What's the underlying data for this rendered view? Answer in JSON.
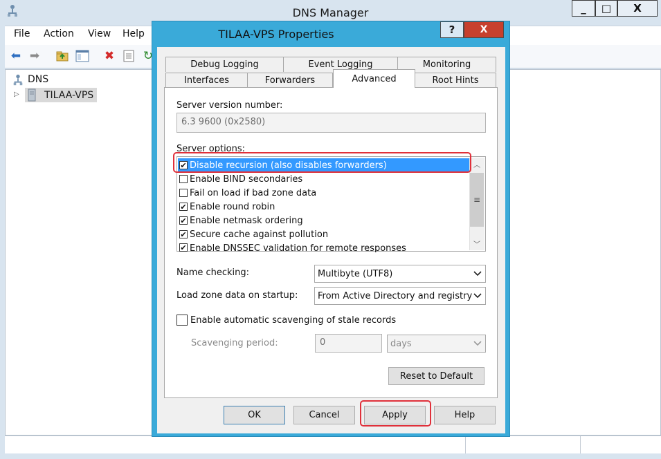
{
  "main_window": {
    "title": "DNS Manager",
    "controls": {
      "minimize": "_",
      "maximize": "□",
      "close": "X"
    },
    "menu": [
      "File",
      "Action",
      "View",
      "Help"
    ],
    "toolbar_icons": [
      "back-arrow-icon",
      "forward-arrow-icon",
      "up-folder-icon",
      "console-tree-icon",
      "delete-icon",
      "properties-icon",
      "refresh-icon"
    ],
    "tree": {
      "root": "DNS",
      "child": "TILAA-VPS",
      "expander": "▷"
    }
  },
  "dialog": {
    "title": "TILAA-VPS Properties",
    "help_symbol": "?",
    "close_symbol": "X",
    "tabs_row1": [
      "Debug Logging",
      "Event Logging",
      "Monitoring"
    ],
    "tabs_row2": [
      "Interfaces",
      "Forwarders",
      "Advanced",
      "Root Hints"
    ],
    "active_tab": "Advanced",
    "server_version_label": "Server version number:",
    "server_version_value": "6.3 9600 (0x2580)",
    "server_options_label": "Server options:",
    "options": [
      {
        "label": "Disable recursion (also disables forwarders)",
        "checked": true,
        "selected": true
      },
      {
        "label": "Enable BIND secondaries",
        "checked": false,
        "selected": false
      },
      {
        "label": "Fail on load if bad zone data",
        "checked": false,
        "selected": false
      },
      {
        "label": "Enable round robin",
        "checked": true,
        "selected": false
      },
      {
        "label": "Enable netmask ordering",
        "checked": true,
        "selected": false
      },
      {
        "label": "Secure cache against pollution",
        "checked": true,
        "selected": false
      },
      {
        "label": "Enable DNSSEC validation for remote responses",
        "checked": true,
        "selected": false
      }
    ],
    "name_checking_label": "Name checking:",
    "name_checking_value": "Multibyte (UTF8)",
    "load_zone_label": "Load zone data on startup:",
    "load_zone_value": "From Active Directory and registry",
    "scavenging_label": "Enable automatic scavenging of stale records",
    "scavenging_checked": false,
    "scavenging_period_label": "Scavenging period:",
    "scavenging_period_value": "0",
    "scavenging_unit": "days",
    "reset_button": "Reset to Default",
    "buttons": {
      "ok": "OK",
      "cancel": "Cancel",
      "apply": "Apply",
      "help": "Help"
    },
    "highlight_color": "#e0303a",
    "selection_color": "#3399ff"
  }
}
